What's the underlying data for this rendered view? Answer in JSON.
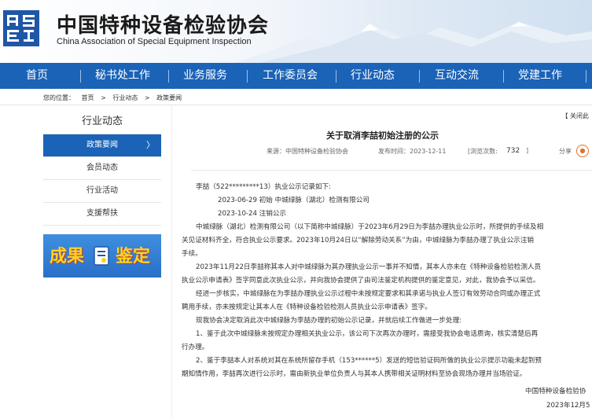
{
  "header": {
    "logo_text": "ASEI",
    "title_cn": "中国特种设备检验协会",
    "title_en": "China Association of Special Equipment Inspection"
  },
  "nav": {
    "items": [
      "首页",
      "秘书处工作",
      "业务服务",
      "工作委员会",
      "行业动态",
      "互动交流",
      "党建工作"
    ]
  },
  "breadcrumb": {
    "label": "您的位置：",
    "home": "首页",
    "sep1": ">",
    "level1": "行业动态",
    "sep2": ">",
    "current": "政策要闻"
  },
  "sidebar": {
    "title": "行业动态",
    "active_chevron": "〉",
    "items": [
      "政策要闻",
      "会员动态",
      "行业活动",
      "支援帮扶"
    ],
    "banner_left": "成果",
    "banner_right": "鉴定"
  },
  "article": {
    "close_label": "【 关闭此",
    "title": "关于取消李喆初始注册的公示",
    "source": "来源：中国特种设备检验协会",
    "publish_time": "发布时间：2023-12-11",
    "views_label": "[浏览次数:",
    "views_count": "732",
    "views_close": "]",
    "share_label": "分享",
    "paragraphs": [
      "李喆（522*********13）执业公示记录如下:",
      "2023-06-29  初始   中城绿脉（湖北）检测有限公司",
      "2023-10-24  注销公示",
      "中城绿脉（湖北）检测有限公司（以下简称中城绿脉）于2023年6月29日为李喆办理执业公示时，所提供的手续及相",
      "关见证材料齐全，符合执业公示要求。2023年10月24日以“解除劳动关系”为由，中城绿脉为李喆办理了执业公示注销",
      "手续。",
      "2023年11月22日李喆称其本人对中城绿脉为其办理执业公示一事并不知情，其本人亦未在《特种设备检验检测人员",
      "执业公示申请表》签字同意此次执业公示，并向我协会提供了由司法鉴定机构提供的鉴定意见，对此，我协会予以采信。",
      "经进一步核实，中城绿脉在为李喆办理执业公示过程中未按规定要求和其承诺与执业人签订有效劳动合同或办理正式",
      "聘用手续，亦未按规定让其本人在《特种设备检验检测人员执业公示申请表》签字。",
      "现我协会决定取消此次中城绿脉为李喆办理的初始公示记录，并就后续工作做进一步处理:",
      "1、鉴于此次中城绿脉未按规定办理相关执业公示，该公司下次再次办理时，需接受我协会电话质询，核实清楚后再",
      "行办理。",
      "2、鉴于李喆本人对系统对其在系统所留存手机（153******5）发送的短信验证码所做的执业公示提示功能未起到预",
      "期知情作用，李喆再次进行公示时，需由新执业单位负责人与其本人携带相关证明材料至协会现场办理并当场验证。"
    ],
    "sign_org": "中国特种设备检验协",
    "sign_date": "2023年12月5"
  },
  "colors": {
    "nav_bg": "#1a63b7",
    "active_bg": "#1a63b7",
    "logo_bg": "#1f57a6",
    "share_accent": "#e0712a"
  }
}
